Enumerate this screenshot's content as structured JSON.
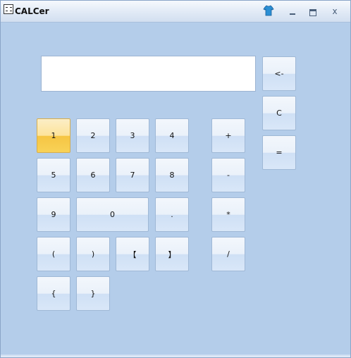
{
  "window": {
    "title": "CALCer",
    "icon": "calculator-icon",
    "extra_icon": "shirt-icon",
    "close_label": "x"
  },
  "display": {
    "value": ""
  },
  "buttons": {
    "backspace": "<-",
    "clear": "C",
    "equals": "=",
    "n1": "1",
    "n2": "2",
    "n3": "3",
    "n4": "4",
    "n5": "5",
    "n6": "6",
    "n7": "7",
    "n8": "8",
    "n9": "9",
    "n0": "0",
    "dot": ".",
    "lparen": "(",
    "rparen": ")",
    "lbracket": "【",
    "rbracket": "】",
    "lbrace": "{",
    "rbrace": "}",
    "plus": "+",
    "minus": "-",
    "multiply": "*",
    "divide": "/"
  },
  "colors": {
    "background": "#b4cdea",
    "active_button": "#f6c543",
    "button": "#dfeaf8"
  }
}
